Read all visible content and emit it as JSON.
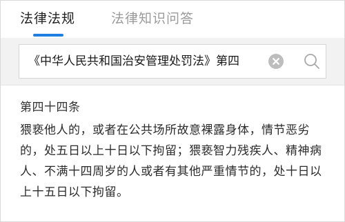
{
  "colors": {
    "accent": "#1e7fe0",
    "tab_inactive": "#9a9a9a",
    "search_bg": "#f2f2f2",
    "clear_icon": "#bdbdbd",
    "search_icon": "#a8a8a8"
  },
  "tabs": [
    {
      "label": "法律法规",
      "active": true
    },
    {
      "label": "法律知识问答",
      "active": false
    }
  ],
  "search": {
    "value": "《中华人民共和国治安管理处罚法》第四",
    "clear_icon": "clear-circle-icon",
    "search_icon": "magnifier-icon"
  },
  "article": {
    "title": "第四十四条",
    "body": "猥亵他人的，或者在公共场所故意裸露身体，情节恶劣的，处五日以上十日以下拘留；猥亵智力残疾人、精神病人、不满十四周岁的人或者有其他严重情节的，处十日以上十五日以下拘留。"
  }
}
